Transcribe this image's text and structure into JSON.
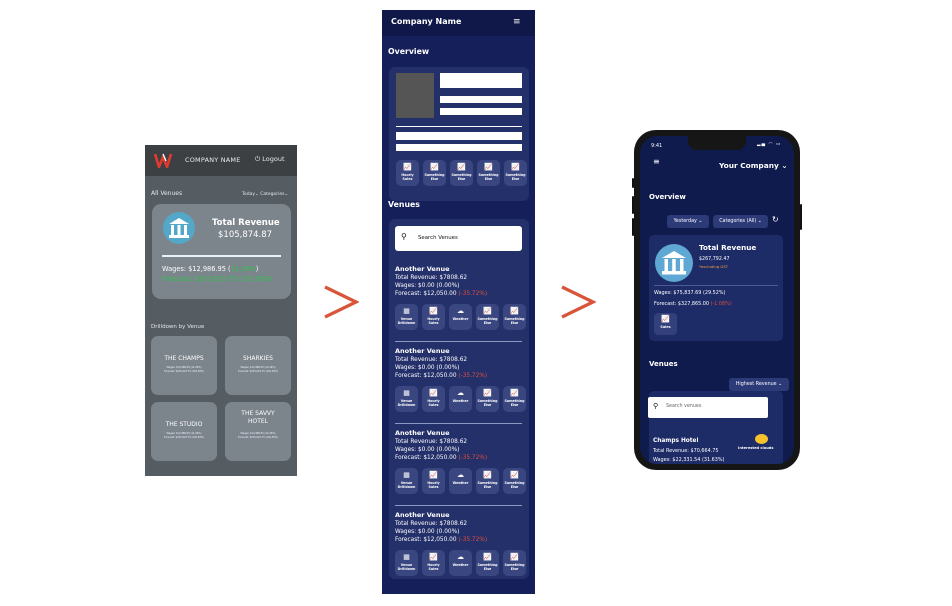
{
  "old_app": {
    "company": "COMPANY NAME",
    "logout": "Logout",
    "all_venues": "All Venues",
    "filter_today": "Today",
    "filter_categories": "Categories",
    "total_revenue_label": "Total Revenue",
    "total_revenue_value": "$105,874.87",
    "wages_text": "Wages: $12,986.95 (",
    "wages_pct": "12.26%",
    "wages_close": ")",
    "forecast_text": "Forecast: $105,623.75 (102.83%)",
    "drilldown": "Drilldown by Venue",
    "venues": [
      {
        "name": "THE CHAMPS",
        "l1": "Wages: $12,986.95 (12.26%)",
        "l2": "Forecast: $105,623.75 (102.83%)"
      },
      {
        "name": "SHARKIES",
        "l1": "Wages: $12,986.95 (12.26%)",
        "l2": "Forecast: $105,623.75 (102.83%)"
      },
      {
        "name": "THE STUDIO",
        "l1": "Wages: $12,986.95 (12.26%)",
        "l2": "Forecast: $105,623.75 (102.83%)"
      },
      {
        "name": "THE SAVVY HOTEL",
        "l1": "Wages: $12,986.95 (12.26%)",
        "l2": "Forecast: $105,623.75 (102.83%)"
      }
    ]
  },
  "mid_app": {
    "company": "Company Name",
    "overview": "Overview",
    "quick_actions": [
      "Hourly Sales",
      "Something Else",
      "Something Else",
      "Something Else",
      "Something Else"
    ],
    "venues_heading": "Venues",
    "search_placeholder": "Search Venues",
    "venue_blocks": [
      {
        "title": "Another Venue",
        "revenue": "Total Revenue: $7808.62",
        "wages": "Wages: $0.00 (0.00%)",
        "forecast": "Forecast: $12,050.00 ",
        "forecast_pct": "(-35.72%)"
      },
      {
        "title": "Another Venue",
        "revenue": "Total Revenue: $7808.62",
        "wages": "Wages: $0.00 (0.00%)",
        "forecast": "Forecast: $12,050.00 ",
        "forecast_pct": "(-35.72%)"
      },
      {
        "title": "Another Venue",
        "revenue": "Total Revenue: $7808.62",
        "wages": "Wages: $0.00 (0.00%)",
        "forecast": "Forecast: $12,050.00 ",
        "forecast_pct": "(-35.72%)"
      },
      {
        "title": "Another Venue",
        "revenue": "Total Revenue: $7808.62",
        "wages": "Wages: $0.00 (0.00%)",
        "forecast": "Forecast: $12,050.00 ",
        "forecast_pct": "(-35.72%)"
      }
    ],
    "venue_actions": [
      "Venue Drilldown",
      "Hourly Sales",
      "Weather",
      "Something Else",
      "Something Else"
    ]
  },
  "phone": {
    "time": "9:41",
    "company": "Your Company",
    "overview": "Overview",
    "filter_period": "Yesterday",
    "filter_categories": "Categories (All)",
    "total_revenue_label": "Total Revenue",
    "total_revenue_value": "$267,792.47",
    "gst_note": "*excluding GST",
    "wages": "Wages: $75,837.69 (29.52%)",
    "forecast": "Forecast: $327,865.00",
    "forecast_pct": " (-1.08%)",
    "quick_action": "Sales",
    "venues": "Venues",
    "sort": "Highest Revenue",
    "search_placeholder": "Search venues",
    "hotel": "Champs Hotel",
    "hotel_revenue": "Total Revenue: $70,664.75",
    "hotel_wages": "Wages: $22,331.54 (31.63%)",
    "chat_label": "Interested clouds"
  },
  "colors": {
    "old_bg": "#555c62",
    "navy": "#15205a",
    "phone_navy": "#0f1b4d",
    "arrow": "#d9553a",
    "positive": "#2ec34e",
    "negative": "#e24d3c"
  }
}
